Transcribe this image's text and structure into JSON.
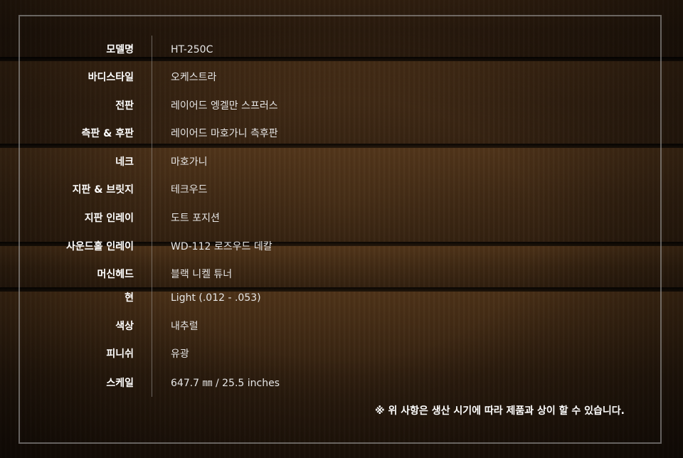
{
  "specs": [
    {
      "label": "모델명",
      "value": "HT-250C"
    },
    {
      "label": "바디스타일",
      "value": "오케스트라"
    },
    {
      "label": "전판",
      "value": "레이어드 엥겔만 스프러스"
    },
    {
      "label": "측판 & 후판",
      "value": "레이어드 마호가니 측후판"
    },
    {
      "label": "네크",
      "value": "마호가니"
    },
    {
      "label": "지판 & 브릿지",
      "value": "테크우드"
    },
    {
      "label": "지판 인레이",
      "value": "도트 포지션"
    },
    {
      "label": "사운드홀 인레이",
      "value": "WD-112 로즈우드 데칼"
    },
    {
      "label": "머신헤드",
      "value": "블랙 니켈 튜너"
    },
    {
      "label": "현",
      "value": "Light (.012 - .053)"
    },
    {
      "label": "색상",
      "value": "내추럴"
    },
    {
      "label": "피니쉬",
      "value": "유광"
    },
    {
      "label": "스케일",
      "value": "647.7 ㎜ / 25.5 inches"
    }
  ],
  "note": "※ 위 사항은 생산 시기에 따라 제품과 상이 할 수 있습니다."
}
